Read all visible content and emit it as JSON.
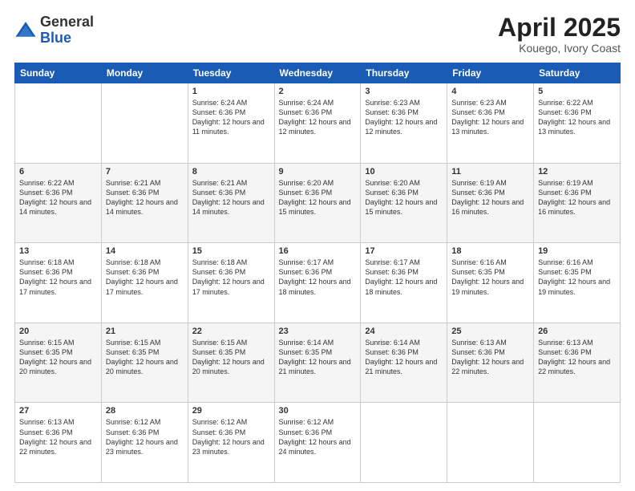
{
  "logo": {
    "general": "General",
    "blue": "Blue"
  },
  "title": "April 2025",
  "location": "Kouego, Ivory Coast",
  "days_of_week": [
    "Sunday",
    "Monday",
    "Tuesday",
    "Wednesday",
    "Thursday",
    "Friday",
    "Saturday"
  ],
  "weeks": [
    [
      {
        "day": "",
        "sunrise": "",
        "sunset": "",
        "daylight": ""
      },
      {
        "day": "",
        "sunrise": "",
        "sunset": "",
        "daylight": ""
      },
      {
        "day": "1",
        "sunrise": "Sunrise: 6:24 AM",
        "sunset": "Sunset: 6:36 PM",
        "daylight": "Daylight: 12 hours and 11 minutes."
      },
      {
        "day": "2",
        "sunrise": "Sunrise: 6:24 AM",
        "sunset": "Sunset: 6:36 PM",
        "daylight": "Daylight: 12 hours and 12 minutes."
      },
      {
        "day": "3",
        "sunrise": "Sunrise: 6:23 AM",
        "sunset": "Sunset: 6:36 PM",
        "daylight": "Daylight: 12 hours and 12 minutes."
      },
      {
        "day": "4",
        "sunrise": "Sunrise: 6:23 AM",
        "sunset": "Sunset: 6:36 PM",
        "daylight": "Daylight: 12 hours and 13 minutes."
      },
      {
        "day": "5",
        "sunrise": "Sunrise: 6:22 AM",
        "sunset": "Sunset: 6:36 PM",
        "daylight": "Daylight: 12 hours and 13 minutes."
      }
    ],
    [
      {
        "day": "6",
        "sunrise": "Sunrise: 6:22 AM",
        "sunset": "Sunset: 6:36 PM",
        "daylight": "Daylight: 12 hours and 14 minutes."
      },
      {
        "day": "7",
        "sunrise": "Sunrise: 6:21 AM",
        "sunset": "Sunset: 6:36 PM",
        "daylight": "Daylight: 12 hours and 14 minutes."
      },
      {
        "day": "8",
        "sunrise": "Sunrise: 6:21 AM",
        "sunset": "Sunset: 6:36 PM",
        "daylight": "Daylight: 12 hours and 14 minutes."
      },
      {
        "day": "9",
        "sunrise": "Sunrise: 6:20 AM",
        "sunset": "Sunset: 6:36 PM",
        "daylight": "Daylight: 12 hours and 15 minutes."
      },
      {
        "day": "10",
        "sunrise": "Sunrise: 6:20 AM",
        "sunset": "Sunset: 6:36 PM",
        "daylight": "Daylight: 12 hours and 15 minutes."
      },
      {
        "day": "11",
        "sunrise": "Sunrise: 6:19 AM",
        "sunset": "Sunset: 6:36 PM",
        "daylight": "Daylight: 12 hours and 16 minutes."
      },
      {
        "day": "12",
        "sunrise": "Sunrise: 6:19 AM",
        "sunset": "Sunset: 6:36 PM",
        "daylight": "Daylight: 12 hours and 16 minutes."
      }
    ],
    [
      {
        "day": "13",
        "sunrise": "Sunrise: 6:18 AM",
        "sunset": "Sunset: 6:36 PM",
        "daylight": "Daylight: 12 hours and 17 minutes."
      },
      {
        "day": "14",
        "sunrise": "Sunrise: 6:18 AM",
        "sunset": "Sunset: 6:36 PM",
        "daylight": "Daylight: 12 hours and 17 minutes."
      },
      {
        "day": "15",
        "sunrise": "Sunrise: 6:18 AM",
        "sunset": "Sunset: 6:36 PM",
        "daylight": "Daylight: 12 hours and 17 minutes."
      },
      {
        "day": "16",
        "sunrise": "Sunrise: 6:17 AM",
        "sunset": "Sunset: 6:36 PM",
        "daylight": "Daylight: 12 hours and 18 minutes."
      },
      {
        "day": "17",
        "sunrise": "Sunrise: 6:17 AM",
        "sunset": "Sunset: 6:36 PM",
        "daylight": "Daylight: 12 hours and 18 minutes."
      },
      {
        "day": "18",
        "sunrise": "Sunrise: 6:16 AM",
        "sunset": "Sunset: 6:35 PM",
        "daylight": "Daylight: 12 hours and 19 minutes."
      },
      {
        "day": "19",
        "sunrise": "Sunrise: 6:16 AM",
        "sunset": "Sunset: 6:35 PM",
        "daylight": "Daylight: 12 hours and 19 minutes."
      }
    ],
    [
      {
        "day": "20",
        "sunrise": "Sunrise: 6:15 AM",
        "sunset": "Sunset: 6:35 PM",
        "daylight": "Daylight: 12 hours and 20 minutes."
      },
      {
        "day": "21",
        "sunrise": "Sunrise: 6:15 AM",
        "sunset": "Sunset: 6:35 PM",
        "daylight": "Daylight: 12 hours and 20 minutes."
      },
      {
        "day": "22",
        "sunrise": "Sunrise: 6:15 AM",
        "sunset": "Sunset: 6:35 PM",
        "daylight": "Daylight: 12 hours and 20 minutes."
      },
      {
        "day": "23",
        "sunrise": "Sunrise: 6:14 AM",
        "sunset": "Sunset: 6:35 PM",
        "daylight": "Daylight: 12 hours and 21 minutes."
      },
      {
        "day": "24",
        "sunrise": "Sunrise: 6:14 AM",
        "sunset": "Sunset: 6:36 PM",
        "daylight": "Daylight: 12 hours and 21 minutes."
      },
      {
        "day": "25",
        "sunrise": "Sunrise: 6:13 AM",
        "sunset": "Sunset: 6:36 PM",
        "daylight": "Daylight: 12 hours and 22 minutes."
      },
      {
        "day": "26",
        "sunrise": "Sunrise: 6:13 AM",
        "sunset": "Sunset: 6:36 PM",
        "daylight": "Daylight: 12 hours and 22 minutes."
      }
    ],
    [
      {
        "day": "27",
        "sunrise": "Sunrise: 6:13 AM",
        "sunset": "Sunset: 6:36 PM",
        "daylight": "Daylight: 12 hours and 22 minutes."
      },
      {
        "day": "28",
        "sunrise": "Sunrise: 6:12 AM",
        "sunset": "Sunset: 6:36 PM",
        "daylight": "Daylight: 12 hours and 23 minutes."
      },
      {
        "day": "29",
        "sunrise": "Sunrise: 6:12 AM",
        "sunset": "Sunset: 6:36 PM",
        "daylight": "Daylight: 12 hours and 23 minutes."
      },
      {
        "day": "30",
        "sunrise": "Sunrise: 6:12 AM",
        "sunset": "Sunset: 6:36 PM",
        "daylight": "Daylight: 12 hours and 24 minutes."
      },
      {
        "day": "",
        "sunrise": "",
        "sunset": "",
        "daylight": ""
      },
      {
        "day": "",
        "sunrise": "",
        "sunset": "",
        "daylight": ""
      },
      {
        "day": "",
        "sunrise": "",
        "sunset": "",
        "daylight": ""
      }
    ]
  ]
}
